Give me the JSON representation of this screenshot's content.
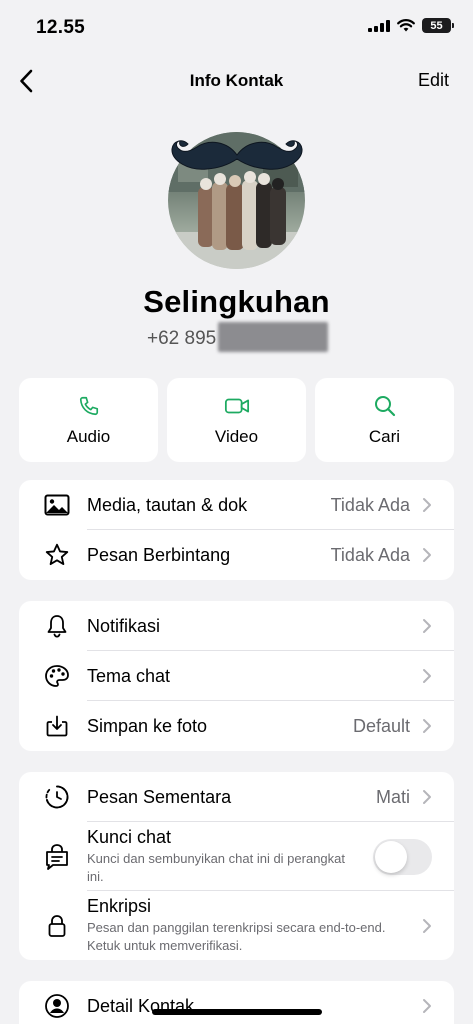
{
  "status_bar": {
    "time": "12.55",
    "battery": "55"
  },
  "nav": {
    "title": "Info Kontak",
    "edit_label": "Edit"
  },
  "contact": {
    "name": "Selingkuhan",
    "phone_visible": "+62 895"
  },
  "actions": [
    {
      "label": "Audio",
      "icon": "phone-icon"
    },
    {
      "label": "Video",
      "icon": "video-icon"
    },
    {
      "label": "Cari",
      "icon": "search-icon"
    }
  ],
  "section1": [
    {
      "label": "Media, tautan & dok",
      "value": "Tidak Ada",
      "icon": "image-icon"
    },
    {
      "label": "Pesan Berbintang",
      "value": "Tidak Ada",
      "icon": "star-icon"
    }
  ],
  "section2": [
    {
      "label": "Notifikasi",
      "value": "",
      "icon": "bell-icon"
    },
    {
      "label": "Tema chat",
      "value": "",
      "icon": "palette-icon"
    },
    {
      "label": "Simpan ke foto",
      "value": "Default",
      "icon": "download-icon"
    }
  ],
  "section3": {
    "disappearing": {
      "label": "Pesan Sementara",
      "value": "Mati",
      "icon": "timer-icon"
    },
    "lock": {
      "label": "Kunci chat",
      "sub": "Kunci dan sembunyikan chat ini di perangkat ini.",
      "icon": "chat-lock-icon",
      "enabled": false
    },
    "encryption": {
      "label": "Enkripsi",
      "sub": "Pesan dan panggilan terenkripsi secara end-to-end. Ketuk untuk memverifikasi.",
      "icon": "lock-icon"
    }
  },
  "section4": {
    "label": "Detail Kontak",
    "icon": "person-circle-icon"
  },
  "colors": {
    "accent": "#1daa61",
    "background": "#f2f2f4",
    "text_secondary": "#6b6b70"
  }
}
